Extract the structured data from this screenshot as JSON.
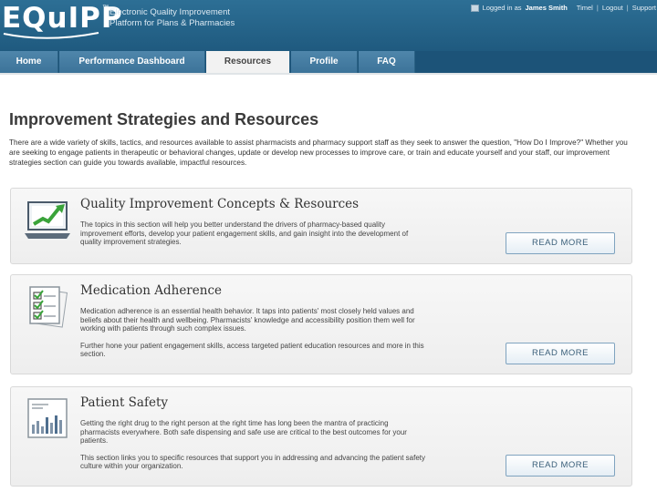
{
  "header": {
    "logo": "EQuIPP",
    "logo_tm": "™",
    "tagline_line1": "Electronic Quality Improvement",
    "tagline_line2": "Platform for Plans & Pharmacies",
    "logged_in_prefix": "Logged in as",
    "user_name": "James Smith",
    "links": [
      "Timel",
      "Logout",
      "Support"
    ],
    "separator": "|"
  },
  "nav": {
    "tabs": [
      {
        "label": "Home",
        "active": false
      },
      {
        "label": "Performance Dashboard",
        "active": false
      },
      {
        "label": "Resources",
        "active": true
      },
      {
        "label": "Profile",
        "active": false
      },
      {
        "label": "FAQ",
        "active": false
      }
    ]
  },
  "main": {
    "title": "Improvement Strategies and Resources",
    "intro": "There are a wide variety of skills, tactics, and resources available to assist pharmacists and pharmacy support staff as they seek to answer the question, \"How Do I Improve?\" Whether you are seeking to engage patients in therapeutic or behavioral changes, update or develop new processes to improve care, or train and educate yourself and your staff, our improvement strategies section can guide you towards available, impactful resources.",
    "cards": [
      {
        "title": "Quality Improvement Concepts & Resources",
        "icon": "laptop-chart-icon",
        "paragraphs": [
          "The topics in this section will help you better understand the drivers of pharmacy-based quality improvement efforts, develop your patient engagement skills, and gain insight into the development of quality improvement strategies."
        ],
        "button": "READ MORE"
      },
      {
        "title": "Medication Adherence",
        "icon": "checklist-icon",
        "paragraphs": [
          "Medication adherence is an essential health behavior. It taps into patients' most closely held values and beliefs about their health and wellbeing. Pharmacists' knowledge and accessibility position them well for working with patients through such complex issues.",
          "Further hone your patient engagement skills, access targeted patient education resources and more in this section."
        ],
        "button": "READ MORE"
      },
      {
        "title": "Patient Safety",
        "icon": "bar-report-icon",
        "paragraphs": [
          "Getting the right drug to the right person at the right time has long been the mantra of practicing pharmacists everywhere. Both safe dispensing and safe use are critical to the best outcomes for your patients.",
          "This section links you to specific resources that support you in addressing and advancing the patient safety culture within your organization."
        ],
        "button": "READ MORE"
      }
    ]
  },
  "colors": {
    "header_bg": "#2d6f95",
    "nav_bg": "#1c5378",
    "tab_bg": "#4f86ab",
    "button_text": "#3a5f7a",
    "chart_green": "#3aa33a"
  }
}
